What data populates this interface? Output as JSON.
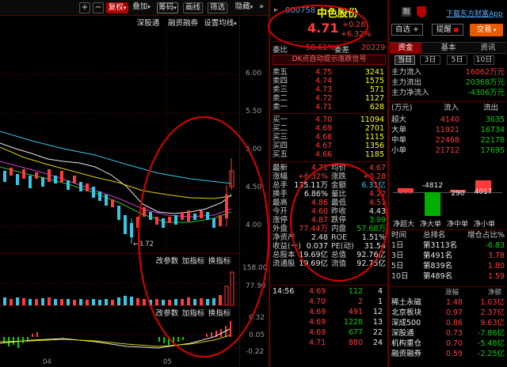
{
  "toolbar": {
    "plus": "+",
    "minus": "−",
    "rights": "复权",
    "overlay": "叠加",
    "chip": "筹码",
    "draw": "画线",
    "select": "筛选",
    "hide": "隐藏",
    "sub_tabs": [
      "深股通",
      "融资融券",
      "设置均线"
    ]
  },
  "chart": {
    "y_labels": [
      "6.00",
      "5.50",
      "5.00",
      "4.50",
      "4.00"
    ],
    "low_label": "3.72",
    "vol_labels": [
      "158.00",
      "77.90"
    ],
    "macd_labels": [
      "0.32",
      "0.05",
      "-0.22"
    ],
    "sub_buttons": [
      "改参数",
      "加指标",
      "换指标"
    ],
    "sub_buttons2": [
      "改参数",
      "加指标",
      "换指标"
    ],
    "x_labels": [
      "04",
      "05"
    ]
  },
  "stock": {
    "code": "000758",
    "name": "中色股份",
    "rong": "融",
    "arrow": "▸",
    "price": "4.71",
    "change": "+0.28",
    "pct": "+6.32%",
    "download": "下载东方财富App"
  },
  "actions": {
    "watch": "自选 +",
    "alert": "提醒",
    "trade": "交易"
  },
  "webi": {
    "label": "委比",
    "value": "58.61%",
    "diff_label": "委差",
    "diff": "20229"
  },
  "signal": "DK点自动提示涨跌信号",
  "asks": [
    {
      "label": "卖五",
      "price": "4.75",
      "vol": "3241"
    },
    {
      "label": "卖四",
      "price": "4.74",
      "vol": "1575"
    },
    {
      "label": "卖三",
      "price": "4.73",
      "vol": "571"
    },
    {
      "label": "卖二",
      "price": "4.72",
      "vol": "1127"
    },
    {
      "label": "卖一",
      "price": "4.71",
      "vol": "628"
    }
  ],
  "bids": [
    {
      "label": "买一",
      "price": "4.70",
      "vol": "11094"
    },
    {
      "label": "买二",
      "price": "4.69",
      "vol": "2701"
    },
    {
      "label": "买三",
      "price": "4.68",
      "vol": "1115"
    },
    {
      "label": "买四",
      "price": "4.67",
      "vol": "1356"
    },
    {
      "label": "买五",
      "price": "4.66",
      "vol": "1185"
    }
  ],
  "stats": [
    {
      "l1": "最新",
      "v1": "4.71",
      "l2": "均价",
      "v2": "4.67"
    },
    {
      "l1": "涨幅",
      "v1": "+6.32%",
      "l2": "涨跌",
      "v2": "+0.28"
    },
    {
      "l1": "总手",
      "v1": "135.11万",
      "l2": "金额",
      "v2": "6.31亿"
    },
    {
      "l1": "换手",
      "v1": "6.86%",
      "l2": "量比",
      "v2": "4.22"
    },
    {
      "l1": "最高",
      "v1": "4.86",
      "l2": "最低",
      "v2": "4.51"
    },
    {
      "l1": "今开",
      "v1": "4.60",
      "l2": "昨收",
      "v2": "4.43"
    },
    {
      "l1": "涨停",
      "v1": "4.87",
      "l2": "跌停",
      "v2": "3.99"
    },
    {
      "l1": "外盘",
      "v1": "77.44万",
      "l2": "内盘",
      "v2": "57.68万"
    },
    {
      "l1": "净资产",
      "v1": "2.48",
      "l2": "ROE",
      "v2": "1.51%"
    },
    {
      "l1": "收益(一)",
      "v1": "0.037",
      "l2": "PE(动)",
      "v2": "31.54"
    },
    {
      "l1": "总股本",
      "v1": "19.69亿",
      "l2": "总值",
      "v2": "92.76亿"
    },
    {
      "l1": "流通股",
      "v1": "19.69亿",
      "l2": "流值",
      "v2": "92.75亿"
    }
  ],
  "ticks": [
    {
      "t": "14:56",
      "p": "4.69",
      "v": "112",
      "n": "4"
    },
    {
      "t": "",
      "p": "4.70",
      "v": "2",
      "n": "1"
    },
    {
      "t": "",
      "p": "4.69",
      "v": "491",
      "n": "12"
    },
    {
      "t": "",
      "p": "4.69",
      "v": "1228",
      "n": "13"
    },
    {
      "t": "",
      "p": "4.69",
      "v": "677",
      "n": "22"
    },
    {
      "t": "",
      "p": "4.71",
      "v": "880",
      "n": "24"
    }
  ],
  "fund_tabs": [
    "资金",
    "基本",
    "资讯"
  ],
  "period_tabs": [
    "当日",
    "3日",
    "5日",
    "10日"
  ],
  "main_flow": [
    {
      "label": "主力流入",
      "value": "16062万元"
    },
    {
      "label": "主力流出",
      "value": "20368万元"
    },
    {
      "label": "主力净流入",
      "value": "-4306万元"
    }
  ],
  "flow_header": {
    "unit": "(万元)",
    "in": "流入",
    "out": "流出"
  },
  "flow_rows": [
    {
      "label": "超大",
      "in": "4140",
      "out": "3635"
    },
    {
      "label": "大单",
      "in": "11921",
      "out": "16734"
    },
    {
      "label": "中单",
      "in": "22468",
      "out": "22178"
    },
    {
      "label": "小单",
      "in": "21712",
      "out": "17695"
    }
  ],
  "bars": [
    {
      "label": "净超大",
      "value": "506"
    },
    {
      "label": "净大单",
      "value": "-4812"
    },
    {
      "label": "净中单",
      "value": "290"
    },
    {
      "label": "净小单",
      "value": "4017"
    }
  ],
  "rank_header": {
    "time": "时间",
    "rank": "总排名",
    "pct": "增仓占比%"
  },
  "rank_rows": [
    {
      "time": "1日",
      "rank": "第3113名",
      "pct": "-6.83"
    },
    {
      "time": "3日",
      "rank": "第491名",
      "pct": "3.78"
    },
    {
      "time": "5日",
      "rank": "第839名",
      "pct": "1.80"
    },
    {
      "time": "10日",
      "rank": "第489名",
      "pct": "1.59"
    }
  ],
  "sector_header": {
    "pct": "涨幅",
    "amount": "净额"
  },
  "sectors": [
    {
      "name": "稀土永磁",
      "pct": "1.48",
      "amount": "1.03亿"
    },
    {
      "name": "北京板块",
      "pct": "0.97",
      "amount": "2.37亿"
    },
    {
      "name": "深成500",
      "pct": "0.86",
      "amount": "9.63亿"
    },
    {
      "name": "深股通",
      "pct": "0.73",
      "amount": "-7.86亿"
    },
    {
      "name": "机构重仓",
      "pct": "0.70",
      "amount": "-5.48亿"
    },
    {
      "name": "融资融券",
      "pct": "0.59",
      "amount": "-2.25亿"
    }
  ]
}
